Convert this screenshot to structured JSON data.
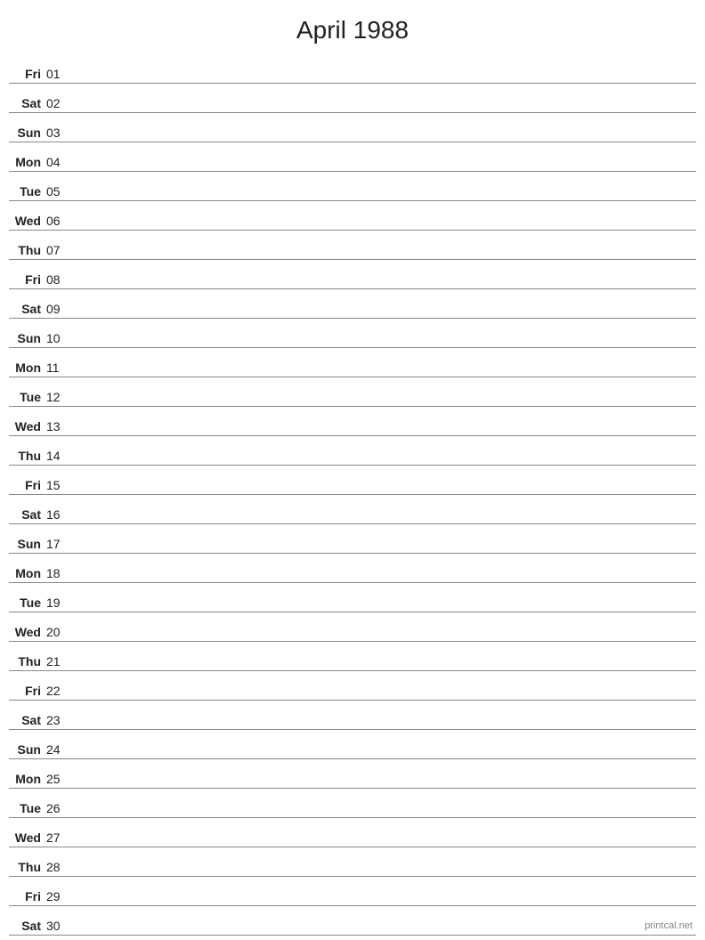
{
  "title": "April 1988",
  "footer": "printcal.net",
  "days": [
    {
      "name": "Fri",
      "number": "01"
    },
    {
      "name": "Sat",
      "number": "02"
    },
    {
      "name": "Sun",
      "number": "03"
    },
    {
      "name": "Mon",
      "number": "04"
    },
    {
      "name": "Tue",
      "number": "05"
    },
    {
      "name": "Wed",
      "number": "06"
    },
    {
      "name": "Thu",
      "number": "07"
    },
    {
      "name": "Fri",
      "number": "08"
    },
    {
      "name": "Sat",
      "number": "09"
    },
    {
      "name": "Sun",
      "number": "10"
    },
    {
      "name": "Mon",
      "number": "11"
    },
    {
      "name": "Tue",
      "number": "12"
    },
    {
      "name": "Wed",
      "number": "13"
    },
    {
      "name": "Thu",
      "number": "14"
    },
    {
      "name": "Fri",
      "number": "15"
    },
    {
      "name": "Sat",
      "number": "16"
    },
    {
      "name": "Sun",
      "number": "17"
    },
    {
      "name": "Mon",
      "number": "18"
    },
    {
      "name": "Tue",
      "number": "19"
    },
    {
      "name": "Wed",
      "number": "20"
    },
    {
      "name": "Thu",
      "number": "21"
    },
    {
      "name": "Fri",
      "number": "22"
    },
    {
      "name": "Sat",
      "number": "23"
    },
    {
      "name": "Sun",
      "number": "24"
    },
    {
      "name": "Mon",
      "number": "25"
    },
    {
      "name": "Tue",
      "number": "26"
    },
    {
      "name": "Wed",
      "number": "27"
    },
    {
      "name": "Thu",
      "number": "28"
    },
    {
      "name": "Fri",
      "number": "29"
    },
    {
      "name": "Sat",
      "number": "30"
    }
  ]
}
